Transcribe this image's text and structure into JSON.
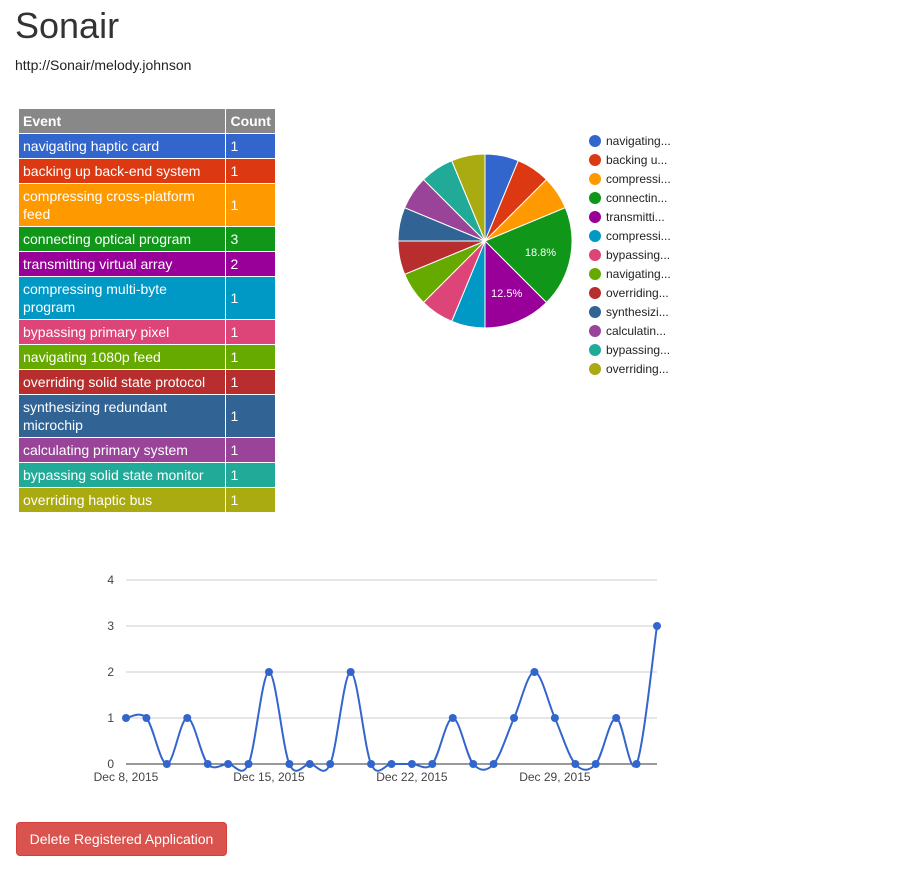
{
  "page": {
    "title": "Sonair",
    "url": "http://Sonair/melody.johnson"
  },
  "table": {
    "headers": [
      "Event",
      "Count"
    ],
    "rows": [
      {
        "event": "navigating haptic card",
        "count": "1",
        "color": "#3366cc"
      },
      {
        "event": "backing up back-end system",
        "count": "1",
        "color": "#dc3912"
      },
      {
        "event": "compressing cross-platform feed",
        "count": "1",
        "color": "#ff9900"
      },
      {
        "event": "connecting optical program",
        "count": "3",
        "color": "#109618"
      },
      {
        "event": "transmitting virtual array",
        "count": "2",
        "color": "#990099"
      },
      {
        "event": "compressing multi-byte program",
        "count": "1",
        "color": "#0099c6"
      },
      {
        "event": "bypassing primary pixel",
        "count": "1",
        "color": "#dd4477"
      },
      {
        "event": "navigating 1080p feed",
        "count": "1",
        "color": "#66aa00"
      },
      {
        "event": "overriding solid state protocol",
        "count": "1",
        "color": "#b82e2e"
      },
      {
        "event": "synthesizing redundant microchip",
        "count": "1",
        "color": "#316395"
      },
      {
        "event": "calculating primary system",
        "count": "1",
        "color": "#994499"
      },
      {
        "event": "bypassing solid state monitor",
        "count": "1",
        "color": "#22aa99"
      },
      {
        "event": "overriding haptic bus",
        "count": "1",
        "color": "#aaaa11"
      }
    ]
  },
  "chart_data": [
    {
      "type": "pie",
      "values": [
        1,
        1,
        1,
        3,
        2,
        1,
        1,
        1,
        1,
        1,
        1,
        1,
        1
      ],
      "legend": [
        "navigating...",
        "backing u...",
        "compressi...",
        "connectin...",
        "transmitti...",
        "compressi...",
        "bypassing...",
        "navigating...",
        "overriding...",
        "synthesizi...",
        "calculatin...",
        "bypassing...",
        "overriding..."
      ],
      "colors": [
        "#3366cc",
        "#dc3912",
        "#ff9900",
        "#109618",
        "#990099",
        "#0099c6",
        "#dd4477",
        "#66aa00",
        "#b82e2e",
        "#316395",
        "#994499",
        "#22aa99",
        "#aaaa11"
      ],
      "slice_labels": [
        "",
        "",
        "",
        "18.8%",
        "12.5%",
        "",
        "",
        "",
        "",
        "",
        "",
        "",
        ""
      ],
      "legend_position": "right"
    },
    {
      "type": "line",
      "x": [
        "2015-12-08",
        "2015-12-09",
        "2015-12-10",
        "2015-12-11",
        "2015-12-12",
        "2015-12-13",
        "2015-12-14",
        "2015-12-15",
        "2015-12-16",
        "2015-12-17",
        "2015-12-18",
        "2015-12-19",
        "2015-12-20",
        "2015-12-21",
        "2015-12-22",
        "2015-12-23",
        "2015-12-24",
        "2015-12-25",
        "2015-12-26",
        "2015-12-27",
        "2015-12-28",
        "2015-12-29",
        "2015-12-30",
        "2015-12-31",
        "2016-01-01",
        "2016-01-02",
        "2016-01-03"
      ],
      "values": [
        1,
        1,
        0,
        1,
        0,
        0,
        0,
        2,
        0,
        0,
        0,
        2,
        0,
        0,
        0,
        0,
        1,
        0,
        0,
        1,
        2,
        1,
        0,
        0,
        1,
        0,
        3
      ],
      "x_tick_labels": [
        "Dec 8, 2015",
        "Dec 15, 2015",
        "Dec 22, 2015",
        "Dec 29, 2015"
      ],
      "y_ticks": [
        "0",
        "1",
        "2",
        "3",
        "4"
      ],
      "ylim": [
        0,
        4
      ],
      "color": "#3366cc",
      "grid": true,
      "legend": "none"
    }
  ],
  "buttons": {
    "delete_label": "Delete Registered Application"
  }
}
